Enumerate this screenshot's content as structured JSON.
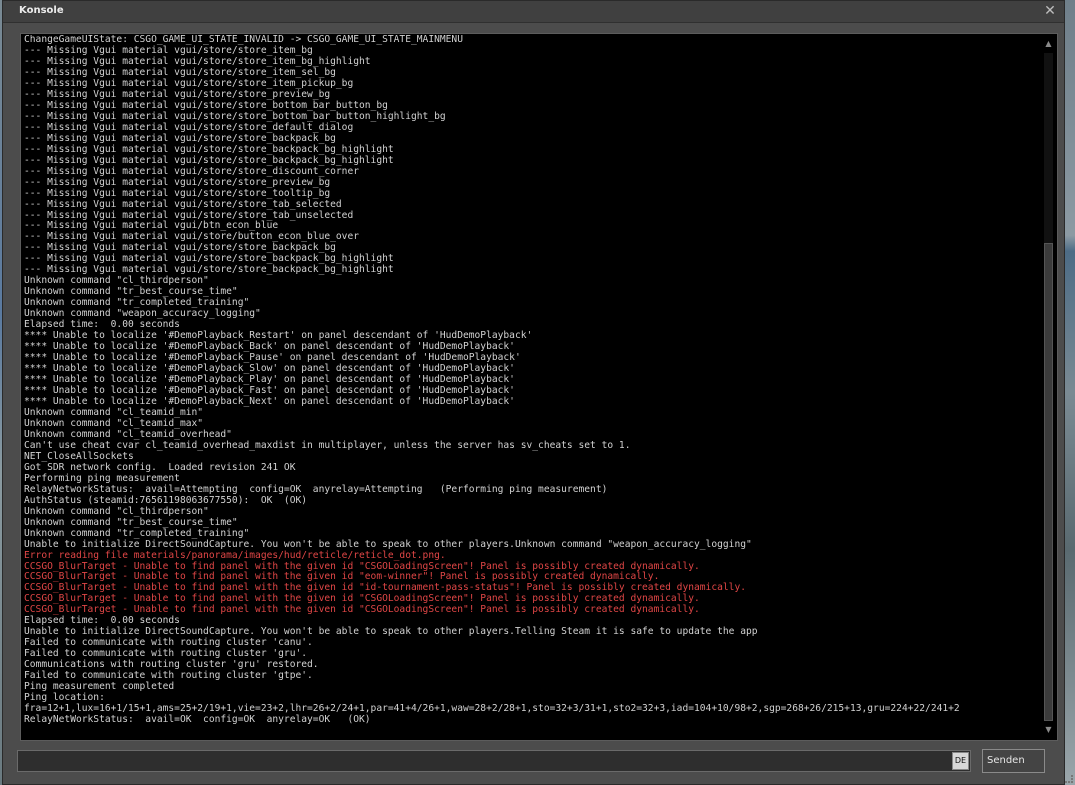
{
  "window": {
    "title": "Konsole",
    "close_glyph": "✕"
  },
  "log_lines": [
    {
      "text": "ChangeGameUIState: CSGO_GAME_UI_STATE_INVALID -> CSGO_GAME_UI_STATE_MAINMENU",
      "error": false
    },
    {
      "text": "--- Missing Vgui material vgui/store/store_item_bg",
      "error": false
    },
    {
      "text": "--- Missing Vgui material vgui/store/store_item_bg_highlight",
      "error": false
    },
    {
      "text": "--- Missing Vgui material vgui/store/store_item_sel_bg",
      "error": false
    },
    {
      "text": "--- Missing Vgui material vgui/store/store_item_pickup_bg",
      "error": false
    },
    {
      "text": "--- Missing Vgui material vgui/store/store_preview_bg",
      "error": false
    },
    {
      "text": "--- Missing Vgui material vgui/store/store_bottom_bar_button_bg",
      "error": false
    },
    {
      "text": "--- Missing Vgui material vgui/store/store_bottom_bar_button_highlight_bg",
      "error": false
    },
    {
      "text": "--- Missing Vgui material vgui/store/store_default_dialog",
      "error": false
    },
    {
      "text": "--- Missing Vgui material vgui/store/store_backpack_bg",
      "error": false
    },
    {
      "text": "--- Missing Vgui material vgui/store/store_backpack_bg_highlight",
      "error": false
    },
    {
      "text": "--- Missing Vgui material vgui/store/store_backpack_bg_highlight",
      "error": false
    },
    {
      "text": "--- Missing Vgui material vgui/store/store_discount_corner",
      "error": false
    },
    {
      "text": "--- Missing Vgui material vgui/store/store_preview_bg",
      "error": false
    },
    {
      "text": "--- Missing Vgui material vgui/store/store_tooltip_bg",
      "error": false
    },
    {
      "text": "--- Missing Vgui material vgui/store/store_tab_selected",
      "error": false
    },
    {
      "text": "--- Missing Vgui material vgui/store/store_tab_unselected",
      "error": false
    },
    {
      "text": "--- Missing Vgui material vgui/btn_econ_blue",
      "error": false
    },
    {
      "text": "--- Missing Vgui material vgui/store/button_econ_blue_over",
      "error": false
    },
    {
      "text": "--- Missing Vgui material vgui/store/store_backpack_bg",
      "error": false
    },
    {
      "text": "--- Missing Vgui material vgui/store/store_backpack_bg_highlight",
      "error": false
    },
    {
      "text": "--- Missing Vgui material vgui/store/store_backpack_bg_highlight",
      "error": false
    },
    {
      "text": "Unknown command \"cl_thirdperson\"",
      "error": false
    },
    {
      "text": "Unknown command \"tr_best_course_time\"",
      "error": false
    },
    {
      "text": "Unknown command \"tr_completed_training\"",
      "error": false
    },
    {
      "text": "Unknown command \"weapon_accuracy_logging\"",
      "error": false
    },
    {
      "text": "Elapsed time:  0.00 seconds",
      "error": false
    },
    {
      "text": "**** Unable to localize '#DemoPlayback_Restart' on panel descendant of 'HudDemoPlayback'",
      "error": false
    },
    {
      "text": "**** Unable to localize '#DemoPlayback_Back' on panel descendant of 'HudDemoPlayback'",
      "error": false
    },
    {
      "text": "**** Unable to localize '#DemoPlayback_Pause' on panel descendant of 'HudDemoPlayback'",
      "error": false
    },
    {
      "text": "**** Unable to localize '#DemoPlayback_Slow' on panel descendant of 'HudDemoPlayback'",
      "error": false
    },
    {
      "text": "**** Unable to localize '#DemoPlayback_Play' on panel descendant of 'HudDemoPlayback'",
      "error": false
    },
    {
      "text": "**** Unable to localize '#DemoPlayback_Fast' on panel descendant of 'HudDemoPlayback'",
      "error": false
    },
    {
      "text": "**** Unable to localize '#DemoPlayback_Next' on panel descendant of 'HudDemoPlayback'",
      "error": false
    },
    {
      "text": "Unknown command \"cl_teamid_min\"",
      "error": false
    },
    {
      "text": "Unknown command \"cl_teamid_max\"",
      "error": false
    },
    {
      "text": "Unknown command \"cl_teamid_overhead\"",
      "error": false
    },
    {
      "text": "Can't use cheat cvar cl_teamid_overhead_maxdist in multiplayer, unless the server has sv_cheats set to 1.",
      "error": false
    },
    {
      "text": "NET_CloseAllSockets",
      "error": false
    },
    {
      "text": "Got SDR network config.  Loaded revision 241 OK",
      "error": false
    },
    {
      "text": "Performing ping measurement",
      "error": false
    },
    {
      "text": "RelayNetworkStatus:  avail=Attempting  config=OK  anyrelay=Attempting   (Performing ping measurement)",
      "error": false
    },
    {
      "text": "AuthStatus (steamid:76561198063677550):  OK  (OK)",
      "error": false
    },
    {
      "text": "Unknown command \"cl_thirdperson\"",
      "error": false
    },
    {
      "text": "Unknown command \"tr_best_course_time\"",
      "error": false
    },
    {
      "text": "Unknown command \"tr_completed_training\"",
      "error": false
    },
    {
      "text": "Unable to initialize DirectSoundCapture. You won't be able to speak to other players.Unknown command \"weapon_accuracy_logging\"",
      "error": false
    },
    {
      "text": "Error reading file materials/panorama/images/hud/reticle/reticle_dot.png.",
      "error": true
    },
    {
      "text": "CCSGO_BlurTarget - Unable to find panel with the given id \"CSGOLoadingScreen\"! Panel is possibly created dynamically.",
      "error": true
    },
    {
      "text": "CCSGO_BlurTarget - Unable to find panel with the given id \"eom-winner\"! Panel is possibly created dynamically.",
      "error": true
    },
    {
      "text": "CCSGO_BlurTarget - Unable to find panel with the given id \"id-tournament-pass-status\"! Panel is possibly created dynamically.",
      "error": true
    },
    {
      "text": "CCSGO_BlurTarget - Unable to find panel with the given id \"CSGOLoadingScreen\"! Panel is possibly created dynamically.",
      "error": true
    },
    {
      "text": "CCSGO_BlurTarget - Unable to find panel with the given id \"CSGOLoadingScreen\"! Panel is possibly created dynamically.",
      "error": true
    },
    {
      "text": "Elapsed time:  0.00 seconds",
      "error": false
    },
    {
      "text": "Unable to initialize DirectSoundCapture. You won't be able to speak to other players.Telling Steam it is safe to update the app",
      "error": false
    },
    {
      "text": "Failed to communicate with routing cluster 'canu'.",
      "error": false
    },
    {
      "text": "Failed to communicate with routing cluster 'gru'.",
      "error": false
    },
    {
      "text": "Communications with routing cluster 'gru' restored.",
      "error": false
    },
    {
      "text": "Failed to communicate with routing cluster 'gtpe'.",
      "error": false
    },
    {
      "text": "Ping measurement completed",
      "error": false
    },
    {
      "text": "Ping location:",
      "error": false
    },
    {
      "text": "fra=12+1,lux=16+1/15+1,ams=25+2/19+1,vie=23+2,lhr=26+2/24+1,par=41+4/26+1,waw=28+2/28+1,sto=32+3/31+1,sto2=32+3,iad=104+10/98+2,sgp=268+26/215+13,gru=224+22/241+2",
      "error": false
    },
    {
      "text": "RelayNetWorkStatus:  avail=OK  config=OK  anyrelay=OK   (OK)",
      "error": false
    }
  ],
  "input": {
    "value": "",
    "placeholder": "",
    "lang_indicator": "DE"
  },
  "send_button": {
    "label": "Senden"
  },
  "scrollbar": {
    "up_glyph": "▲",
    "down_glyph": "▼",
    "position_fraction": 1.0
  },
  "colors": {
    "normal_text": "#d2d2d2",
    "error_text": "#e04646",
    "panel_bg": "#000000",
    "window_bg": "#4c4c4c"
  }
}
